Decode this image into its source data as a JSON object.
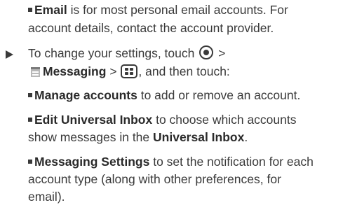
{
  "email_item": {
    "term": "Email",
    "line1_rest": " is for most personal email accounts. For",
    "line2": "account details, contact the account provider."
  },
  "step": {
    "line1_text": "To change your settings, touch",
    "gt1": " >",
    "messaging_label": "Messaging",
    "gt2": " > ",
    "line2_tail": ", and then touch:",
    "icons": [
      "home-icon",
      "messaging-icon",
      "menu-icon"
    ]
  },
  "manage_item": {
    "term": "Manage accounts",
    "rest": " to add or remove an account."
  },
  "edit_item": {
    "term": "Edit Universal Inbox",
    "line1_rest": " to choose which accounts",
    "line2_text": "show messages in the ",
    "line2_term": "Universal Inbox",
    "line2_end": "."
  },
  "settings_item": {
    "term": "Messaging Settings",
    "line1_rest": " to set the notification for each",
    "line2": "account type (along with other preferences, for",
    "line3": "email)."
  }
}
